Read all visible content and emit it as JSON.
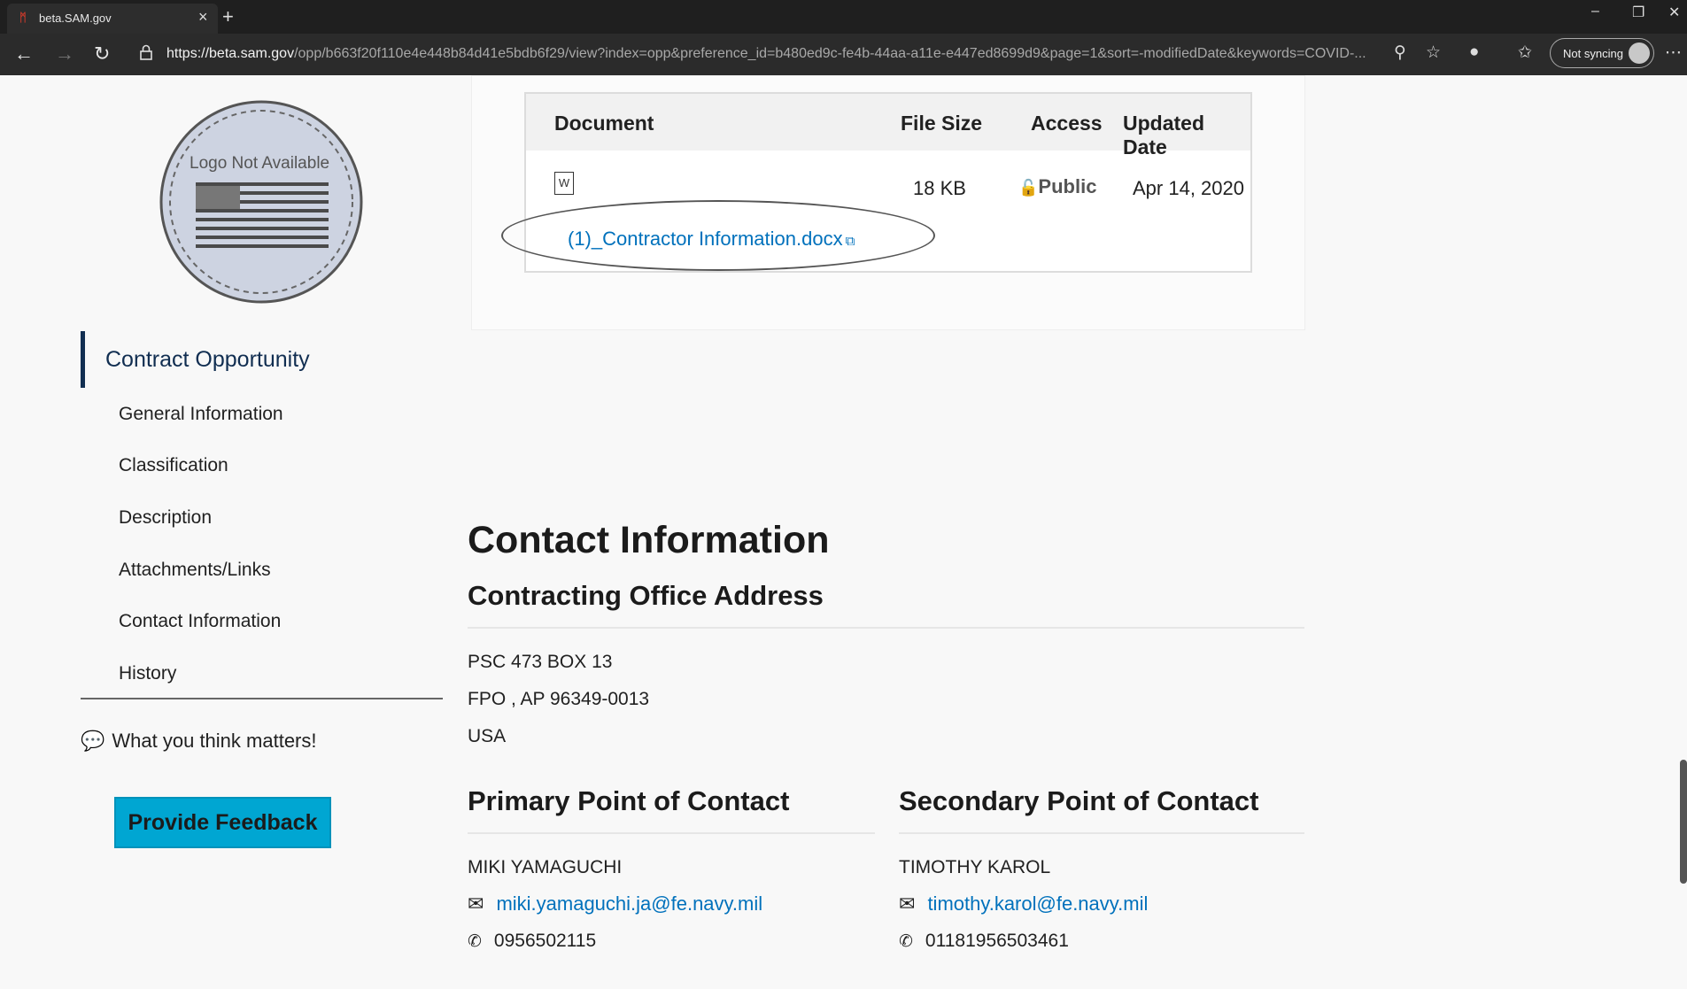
{
  "browser": {
    "tab_title": "beta.SAM.gov",
    "url_host": "https://beta.sam.gov",
    "url_path": "/opp/b663f20f110e4e448b84d41e5bdb6f29/view?index=opp&preference_id=b480ed9c-fe4b-44aa-a11e-e447ed8699d9&page=1&sort=-modifiedDate&keywords=COVID-...",
    "sync_label": "Not syncing"
  },
  "sidebar": {
    "logo_text": "Logo Not Available",
    "title": "Contract Opportunity",
    "items": [
      {
        "label": "General Information"
      },
      {
        "label": "Classification"
      },
      {
        "label": "Description"
      },
      {
        "label": "Attachments/Links"
      },
      {
        "label": "Contact Information"
      },
      {
        "label": "History"
      }
    ],
    "feedback_prompt": "What you think matters!",
    "feedback_button": "Provide Feedback"
  },
  "attachments": {
    "headers": {
      "document": "Document",
      "file_size": "File Size",
      "access": "Access",
      "updated": "Updated Date"
    },
    "rows": [
      {
        "document": "(1)_Contractor Information.docx",
        "file_size": "18 KB",
        "access": "Public",
        "updated": "Apr 14, 2020"
      }
    ]
  },
  "contact": {
    "title": "Contact Information",
    "office_heading": "Contracting Office Address",
    "address": [
      "PSC 473 BOX 13",
      "FPO , AP 96349-0013",
      "USA"
    ],
    "primary": {
      "heading": "Primary Point of Contact",
      "name": "MIKI YAMAGUCHI",
      "email": "miki.yamaguchi.ja@fe.navy.mil",
      "phone": "0956502115"
    },
    "secondary": {
      "heading": "Secondary Point of Contact",
      "name": "TIMOTHY KAROL",
      "email": "timothy.karol@fe.navy.mil",
      "phone": "01181956503461"
    }
  },
  "colors": {
    "link": "#0071bc",
    "nav_accent": "#112e51",
    "feedback_button": "#00a6d2"
  }
}
